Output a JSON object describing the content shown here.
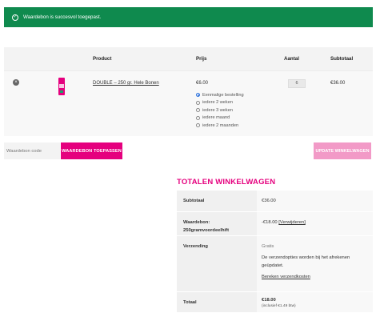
{
  "notice": {
    "message": "Waardebon is succesvol toegepast.",
    "icon": "check-circle-icon",
    "color": "#0f8a4e"
  },
  "cart": {
    "headers": {
      "product": "Product",
      "price": "Prijs",
      "quantity": "Aantal",
      "subtotal": "Subtotaal"
    },
    "item": {
      "remove": "×",
      "name": "DOUBLE – 250 gr. Hele Bonen",
      "price": "€6.00",
      "options": [
        "Eenmalige bestelling",
        "iedere 2 weken",
        "iedere 3 weken",
        "iedere maand",
        "iedere 2 maanden"
      ],
      "selected_option": "Eenmalige bestelling",
      "quantity": "6",
      "subtotal": "€36.00"
    },
    "coupon_placeholder": "Waardebon code",
    "apply_coupon": "WAARDEBON TOEPASSEN",
    "update_cart": "UPDATE WINKELWAGEN"
  },
  "totals": {
    "title": "TOTALEN WINKELWAGEN",
    "subtotal_label": "Subtotaal",
    "subtotal_value": "€36.00",
    "coupon_label_1": "Waardebon:",
    "coupon_label_2": "250gramvoordeelhift",
    "coupon_value": "-€18.00",
    "coupon_remove": "[Verwijderen]",
    "shipping_label": "Verzending",
    "shipping_value": "Gratis",
    "shipping_note_1": "De verzendopties worden bij het afrekenen",
    "shipping_note_2": "geüpdatet.",
    "shipping_calc": "Bereken verzendkosten",
    "total_label": "Totaal",
    "total_value": "€18.00",
    "total_tax": "(inclusief €1.49 btw)"
  },
  "colors": {
    "brand": "#e5007e",
    "brand_light": "#f29ac7",
    "success": "#0f8a4e"
  }
}
